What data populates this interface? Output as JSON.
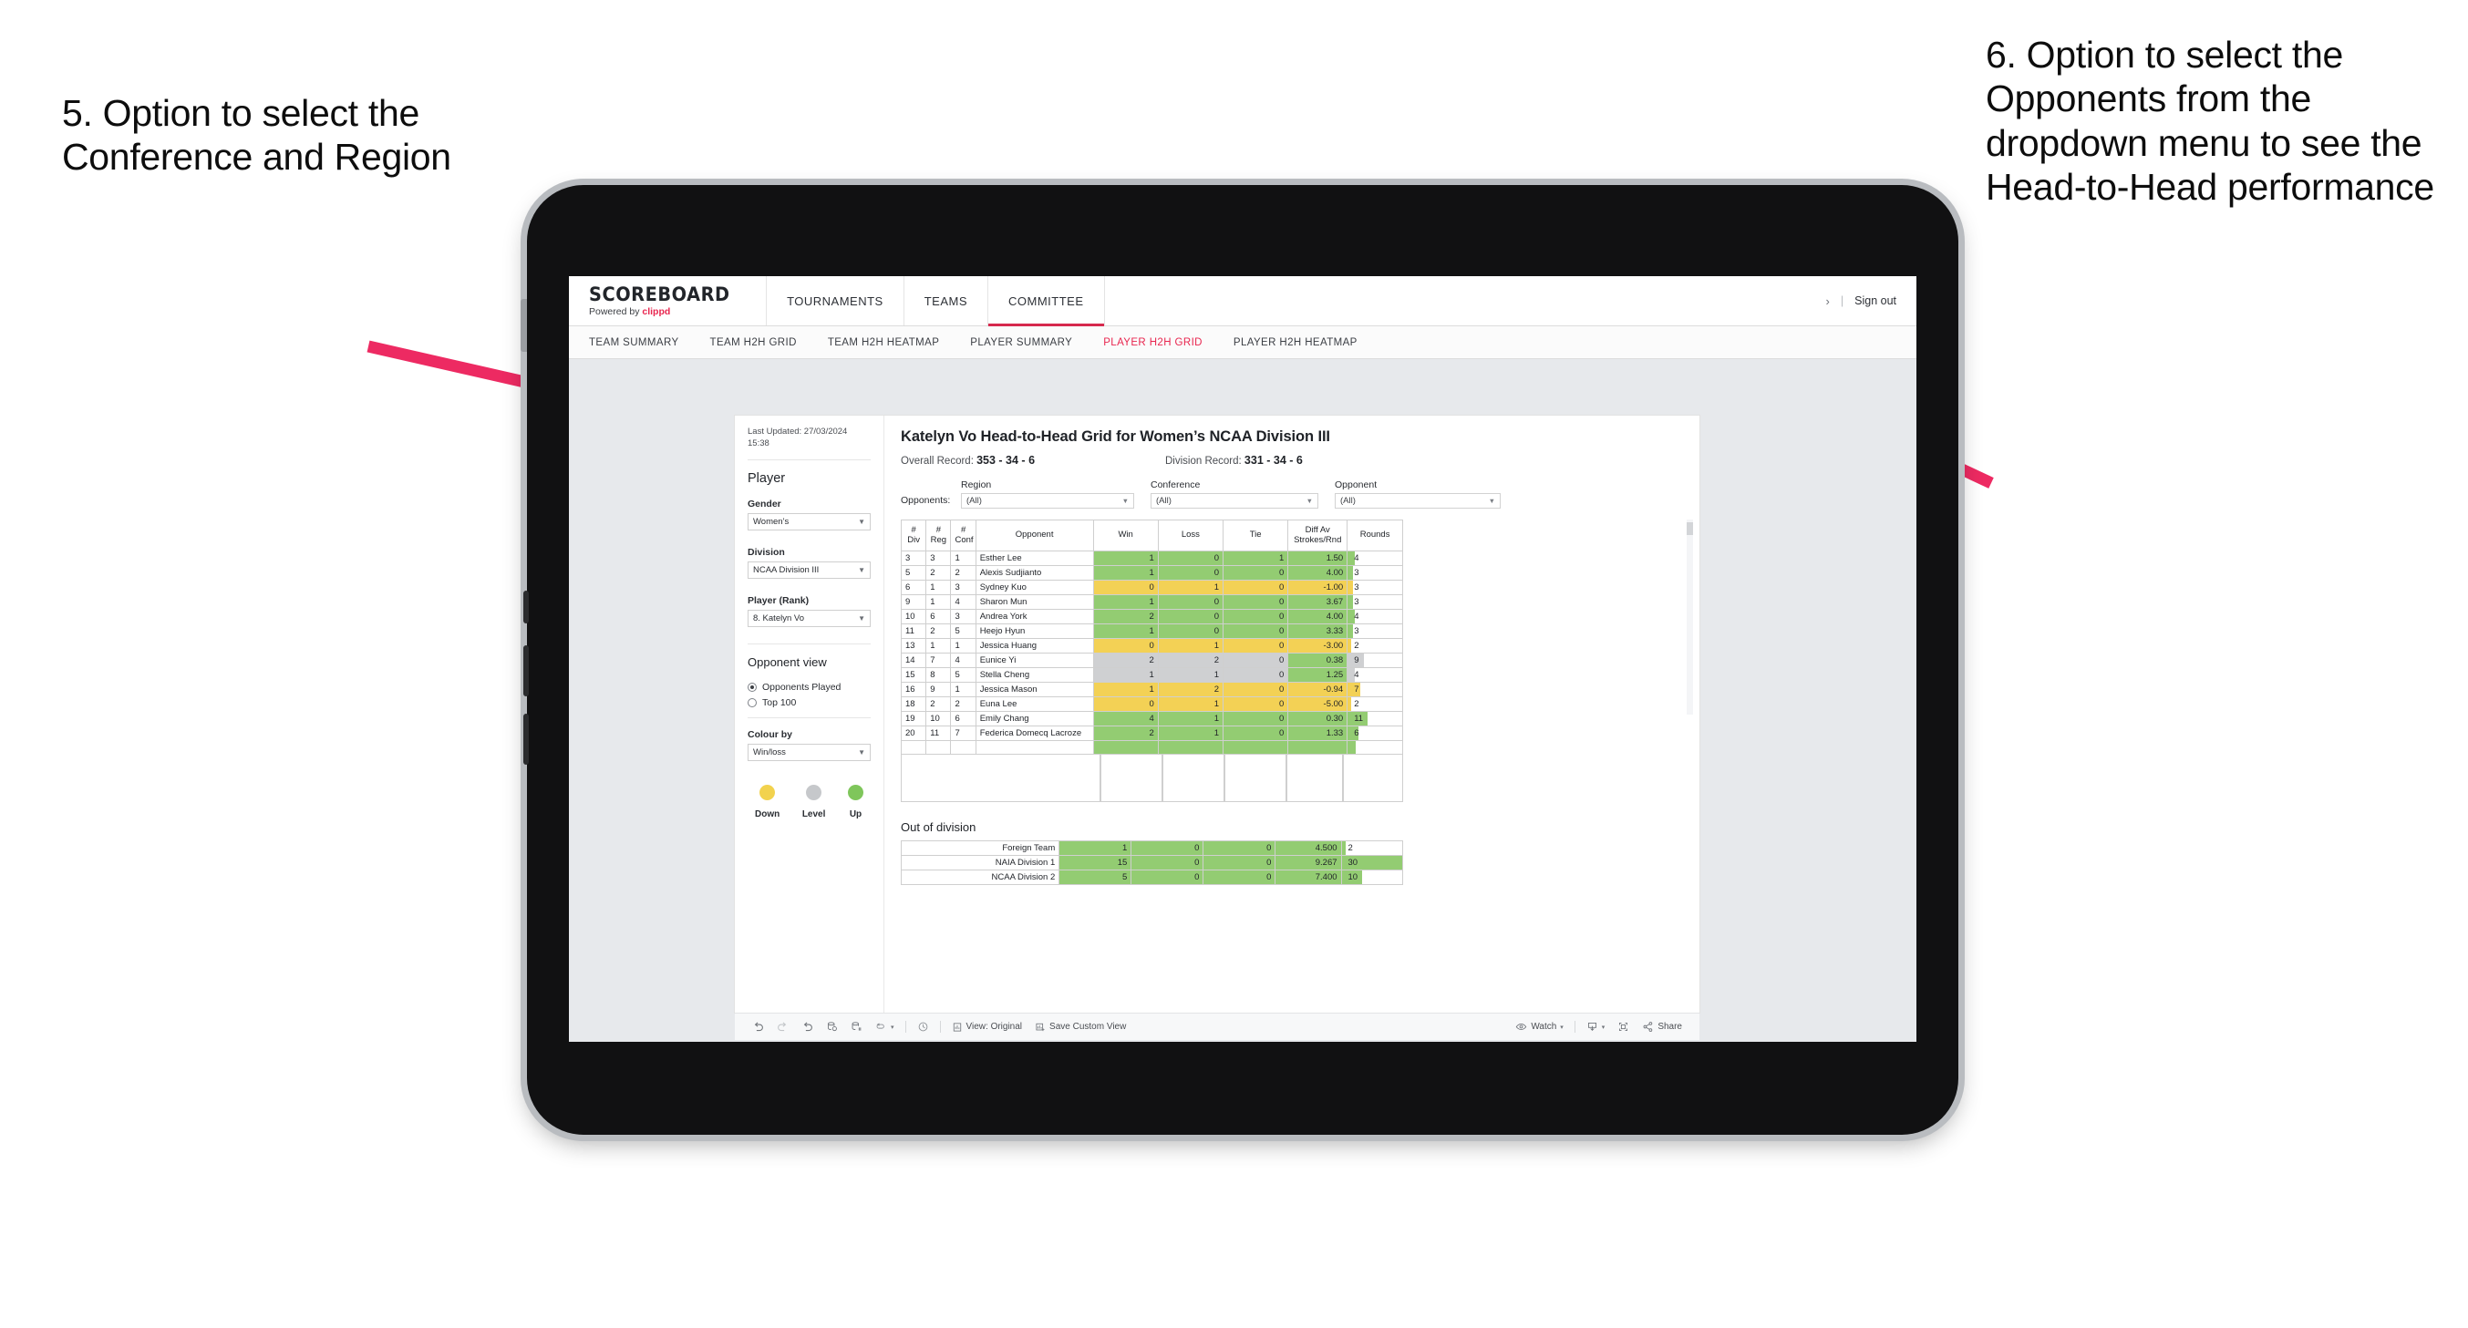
{
  "annotations": {
    "left": "5. Option to select the Conference and Region",
    "right": "6. Option to select the Opponents from the dropdown menu to see the Head-to-Head performance"
  },
  "header": {
    "brand_name": "SCOREBOARD",
    "brand_sub_prefix": "Powered by ",
    "brand_sub_accent": "clippd",
    "nav": [
      {
        "label": "TOURNAMENTS",
        "active": false
      },
      {
        "label": "TEAMS",
        "active": false
      },
      {
        "label": "COMMITTEE",
        "active": true
      }
    ],
    "chevron": "›",
    "separator": "|",
    "sign_out": "Sign out"
  },
  "subnav": [
    {
      "label": "TEAM SUMMARY",
      "active": false
    },
    {
      "label": "TEAM H2H GRID",
      "active": false
    },
    {
      "label": "TEAM H2H HEATMAP",
      "active": false
    },
    {
      "label": "PLAYER SUMMARY",
      "active": false
    },
    {
      "label": "PLAYER H2H GRID",
      "active": true
    },
    {
      "label": "PLAYER H2H HEATMAP",
      "active": false
    }
  ],
  "sidebar": {
    "last_updated": "Last Updated: 27/03/2024 15:38",
    "section_player": "Player",
    "gender_label": "Gender",
    "gender_value": "Women’s",
    "division_label": "Division",
    "division_value": "NCAA Division III",
    "player_label": "Player (Rank)",
    "player_value": "8. Katelyn Vo",
    "opponent_view_label": "Opponent view",
    "opponent_view_options": [
      {
        "label": "Opponents Played",
        "selected": true
      },
      {
        "label": "Top 100",
        "selected": false
      }
    ],
    "colour_by_label": "Colour by",
    "colour_by_value": "Win/loss",
    "legend": [
      {
        "label": "Down",
        "color": "#f2d24e"
      },
      {
        "label": "Level",
        "color": "#c6c8cb"
      },
      {
        "label": "Up",
        "color": "#7fc65b"
      }
    ]
  },
  "viz": {
    "title": "Katelyn Vo Head-to-Head Grid for Women’s NCAA Division III",
    "overall_record_label": "Overall Record: ",
    "overall_record_value": "353 - 34 - 6",
    "division_record_label": "Division Record: ",
    "division_record_value": "331 - 34 - 6",
    "opponents_label": "Opponents:",
    "filters": [
      {
        "label": "Region",
        "value": "(All)"
      },
      {
        "label": "Conference",
        "value": "(All)"
      },
      {
        "label": "Opponent",
        "value": "(All)"
      }
    ],
    "columns": [
      "# Div",
      "# Reg",
      "# Conf",
      "Opponent",
      "Win",
      "Loss",
      "Tie",
      "Diff Av Strokes/Rnd",
      "Rounds"
    ],
    "out_of_division_label": "Out of division"
  },
  "chart_data": {
    "type": "table",
    "title": "Katelyn Vo Head-to-Head Grid for Women’s NCAA Division III",
    "columns": [
      "#Div",
      "#Reg",
      "#Conf",
      "Opponent",
      "Win",
      "Loss",
      "Tie",
      "Diff Av Strokes/Rnd",
      "Rounds"
    ],
    "rounds_max": 30,
    "rows": [
      {
        "div": "3",
        "reg": "3",
        "conf": "1",
        "opponent": "Esther Lee",
        "win": "1",
        "loss": "0",
        "tie": "1",
        "diff": "1.50",
        "rounds": "4",
        "state": "win"
      },
      {
        "div": "5",
        "reg": "2",
        "conf": "2",
        "opponent": "Alexis Sudjianto",
        "win": "1",
        "loss": "0",
        "tie": "0",
        "diff": "4.00",
        "rounds": "3",
        "state": "win"
      },
      {
        "div": "6",
        "reg": "1",
        "conf": "3",
        "opponent": "Sydney Kuo",
        "win": "0",
        "loss": "1",
        "tie": "0",
        "diff": "-1.00",
        "rounds": "3",
        "state": "loss"
      },
      {
        "div": "9",
        "reg": "1",
        "conf": "4",
        "opponent": "Sharon Mun",
        "win": "1",
        "loss": "0",
        "tie": "0",
        "diff": "3.67",
        "rounds": "3",
        "state": "win"
      },
      {
        "div": "10",
        "reg": "6",
        "conf": "3",
        "opponent": "Andrea York",
        "win": "2",
        "loss": "0",
        "tie": "0",
        "diff": "4.00",
        "rounds": "4",
        "state": "win"
      },
      {
        "div": "11",
        "reg": "2",
        "conf": "5",
        "opponent": "Heejo Hyun",
        "win": "1",
        "loss": "0",
        "tie": "0",
        "diff": "3.33",
        "rounds": "3",
        "state": "win"
      },
      {
        "div": "13",
        "reg": "1",
        "conf": "1",
        "opponent": "Jessica Huang",
        "win": "0",
        "loss": "1",
        "tie": "0",
        "diff": "-3.00",
        "rounds": "2",
        "state": "loss"
      },
      {
        "div": "14",
        "reg": "7",
        "conf": "4",
        "opponent": "Eunice Yi",
        "win": "2",
        "loss": "2",
        "tie": "0",
        "diff": "0.38",
        "rounds": "9",
        "state": "lvl",
        "diff_state": "win"
      },
      {
        "div": "15",
        "reg": "8",
        "conf": "5",
        "opponent": "Stella Cheng",
        "win": "1",
        "loss": "1",
        "tie": "0",
        "diff": "1.25",
        "rounds": "4",
        "state": "lvl",
        "diff_state": "win"
      },
      {
        "div": "16",
        "reg": "9",
        "conf": "1",
        "opponent": "Jessica Mason",
        "win": "1",
        "loss": "2",
        "tie": "0",
        "diff": "-0.94",
        "rounds": "7",
        "state": "loss"
      },
      {
        "div": "18",
        "reg": "2",
        "conf": "2",
        "opponent": "Euna Lee",
        "win": "0",
        "loss": "1",
        "tie": "0",
        "diff": "-5.00",
        "rounds": "2",
        "state": "loss"
      },
      {
        "div": "19",
        "reg": "10",
        "conf": "6",
        "opponent": "Emily Chang",
        "win": "4",
        "loss": "1",
        "tie": "0",
        "diff": "0.30",
        "rounds": "11",
        "state": "win"
      },
      {
        "div": "20",
        "reg": "11",
        "conf": "7",
        "opponent": "Federica Domecq Lacroze",
        "win": "2",
        "loss": "1",
        "tie": "0",
        "diff": "1.33",
        "rounds": "6",
        "state": "win"
      }
    ],
    "out_of_division": [
      {
        "name": "Foreign Team",
        "win": "1",
        "loss": "0",
        "tie": "0",
        "diff": "4.500",
        "rounds": "2",
        "state": "win"
      },
      {
        "name": "NAIA Division 1",
        "win": "15",
        "loss": "0",
        "tie": "0",
        "diff": "9.267",
        "rounds": "30",
        "state": "win"
      },
      {
        "name": "NCAA Division 2",
        "win": "5",
        "loss": "0",
        "tie": "0",
        "diff": "7.400",
        "rounds": "10",
        "state": "win"
      }
    ]
  },
  "toolbar": {
    "view_original": "View: Original",
    "save_custom_view": "Save Custom View",
    "watch": "Watch",
    "share": "Share",
    "caret": "▾"
  }
}
